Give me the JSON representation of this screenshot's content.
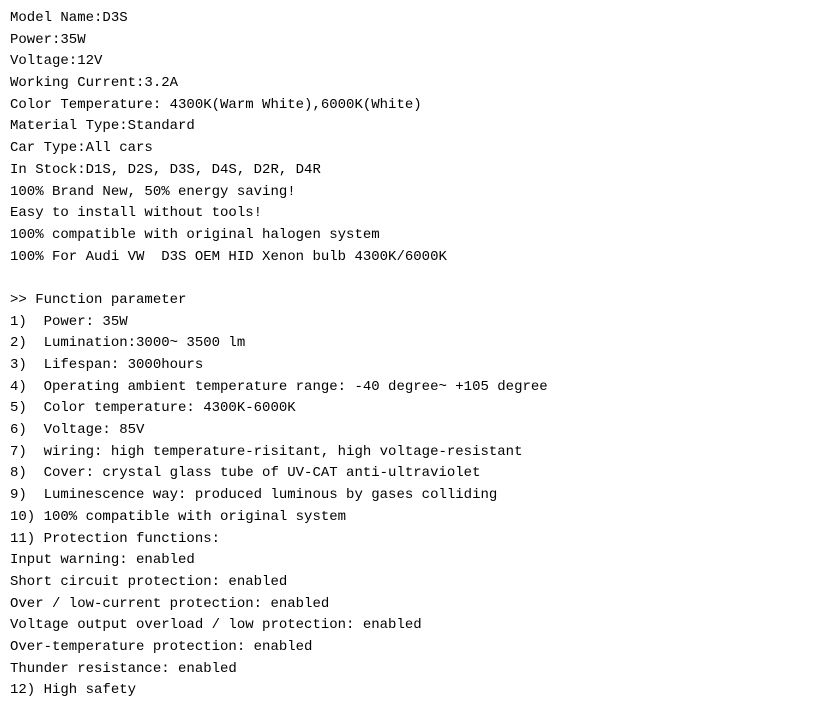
{
  "content": {
    "lines": [
      "Model Name:D3S",
      "Power:35W",
      "Voltage:12V",
      "Working Current:3.2A",
      "Color Temperature: 4300K(Warm White),6000K(White)",
      "Material Type:Standard",
      "Car Type:All cars",
      "In Stock:D1S, D2S, D3S, D4S, D2R, D4R",
      "100% Brand New, 50% energy saving!",
      "Easy to install without tools!",
      "100% compatible with original halogen system",
      "100% For Audi VW  D3S OEM HID Xenon bulb 4300K/6000K",
      "",
      ">> Function parameter",
      "1)  Power: 35W",
      "2)  Lumination:3000~ 3500 lm",
      "3)  Lifespan: 3000hours",
      "4)  Operating ambient temperature range: -40 degree~ +105 degree",
      "5)  Color temperature: 4300K-6000K",
      "6)  Voltage: 85V",
      "7)  wiring: high temperature-risitant, high voltage-resistant",
      "8)  Cover: crystal glass tube of UV-CAT anti-ultraviolet",
      "9)  Luminescence way: produced luminous by gases colliding",
      "10) 100% compatible with original system",
      "11) Protection functions:",
      "Input warning: enabled",
      "Short circuit protection: enabled",
      "Over / low-current protection: enabled",
      "Voltage output overload / low protection: enabled",
      "Over-temperature protection: enabled",
      "Thunder resistance: enabled",
      "12) High safety"
    ]
  }
}
